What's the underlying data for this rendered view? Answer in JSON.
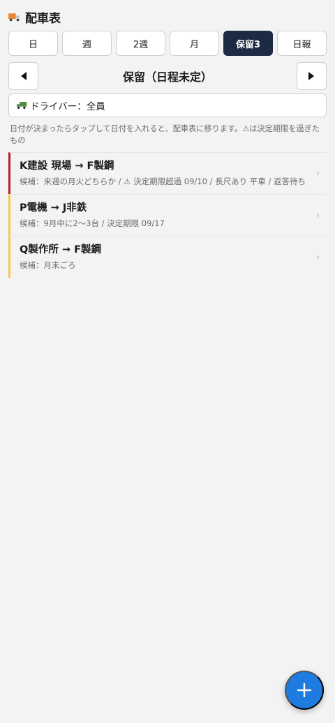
{
  "header": {
    "icon": "delivery-truck-icon",
    "title": "配車表"
  },
  "view_tabs": [
    {
      "label": "日",
      "active": false
    },
    {
      "label": "週",
      "active": false
    },
    {
      "label": "2週",
      "active": false
    },
    {
      "label": "月",
      "active": false
    },
    {
      "label": "保留3",
      "active": true
    },
    {
      "label": "日報",
      "active": false
    }
  ],
  "period_nav": {
    "prev_icon": "triangle-left-icon",
    "title": "保留（日程未定）",
    "next_icon": "triangle-right-icon"
  },
  "driver_filter": {
    "icon": "truck-icon",
    "label": "ドライバー：全員"
  },
  "hint": "日付が決まったらタップして日付を入れると、配車表に移ります。⚠は決定期限を過ぎたもの",
  "hold_items": [
    {
      "route": "K建設 現場 → F製鋼",
      "detail": "候補：来週の月火どちらか / ⚠ 決定期限超過 09/10 / 長尺あり 平車 / 返答待ち",
      "overdue": true
    },
    {
      "route": "P電機 → J非鉄",
      "detail": "候補：9月中に2〜3台 / 決定期限 09/17",
      "overdue": false
    },
    {
      "route": "Q製作所 → F製鋼",
      "detail": "候補：月末ごろ",
      "overdue": false
    }
  ],
  "chevron": "›",
  "fab": {
    "icon": "plus-icon"
  },
  "colors": {
    "active_tab": "#1d2a44",
    "overdue_accent": "#b71c2b",
    "pending_accent": "#f2c94c",
    "fab": "#1e7be0"
  }
}
